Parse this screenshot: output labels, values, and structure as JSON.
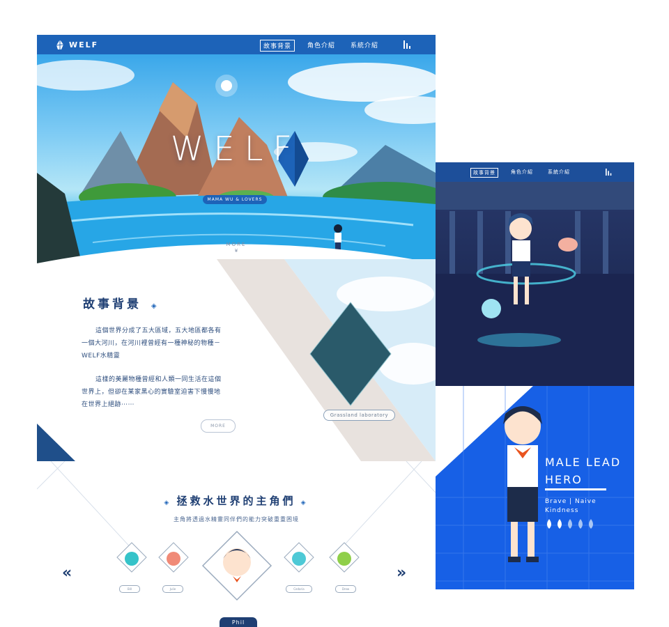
{
  "nav": {
    "logo": "WELF",
    "links": [
      "故事背景",
      "角色介紹",
      "系統介紹"
    ],
    "active": "故事背景",
    "menu_icon": "bars-icon"
  },
  "hero": {
    "title": "WELF",
    "subtitle": "MAMA WU & LOVERS",
    "more": "MORE",
    "more_icon": "chevron-down-icon"
  },
  "story": {
    "title": "故事背景",
    "paragraphs": [
      "這個世界分成了五大區域，五大地區都各有一個大河川，在河川裡曾經有一種神秘的物種－WELF水精靈",
      "這樣的美麗物種曾經和人類一同生活在這個世界上，但卻在某家黑心的實驗室迫害下慢慢地在世界上絕跡⋯⋯"
    ],
    "button": "MORE",
    "location_button": "Grassland laboratory"
  },
  "heroes": {
    "title": "拯救水世界的主角們",
    "subtitle": "主角將透過水精靈同伴們的能力突破重重困境",
    "prev_icon": "double-chevron-left-icon",
    "next_icon": "double-chevron-right-icon",
    "characters": [
      {
        "name": "Bill",
        "color": "#35c3c9"
      },
      {
        "name": "Julie",
        "color": "#f08a77"
      },
      {
        "name": "Phil",
        "color": "#2a3a5c"
      },
      {
        "name": "Cedaria",
        "color": "#4ec9d6"
      },
      {
        "name": "Drew",
        "color": "#8fcf4a"
      }
    ],
    "selected": "Phil"
  },
  "character_panel": {
    "nav_links": [
      "故事背景",
      "角色介紹",
      "系統介紹"
    ],
    "active": "故事背景"
  },
  "character_card": {
    "title_line1": "MALE LEAD",
    "title_line2": "HERO",
    "traits_line1": "Brave | Naive",
    "traits_line2": "Kindness",
    "drops_filled": 2,
    "drops_total": 5
  },
  "colors": {
    "primary": "#1d63b8",
    "navy": "#1f3f73",
    "card_blue": "#1760e6"
  }
}
